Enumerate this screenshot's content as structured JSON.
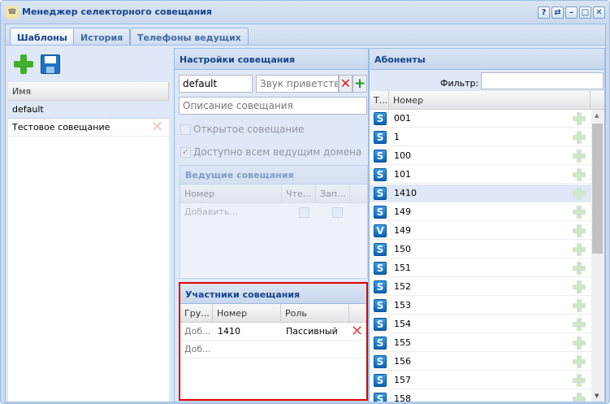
{
  "window": {
    "title": "Менеджер селекторного совещания",
    "buttons": [
      "?",
      "⇄",
      "–",
      "□",
      "✕"
    ]
  },
  "tabs": [
    {
      "label": "Шаблоны",
      "active": true
    },
    {
      "label": "История"
    },
    {
      "label": "Телефоны ведущих"
    }
  ],
  "templates": {
    "column": "Имя",
    "rows": [
      {
        "name": "default",
        "selected": true
      },
      {
        "name": "Тестовое совещание"
      }
    ]
  },
  "settings": {
    "title": "Настройки совещания",
    "name_value": "default",
    "sound_placeholder": "Звук приветствия",
    "description_placeholder": "Описание совещания",
    "open_label": "Открытое совещание",
    "open_checked": false,
    "domain_label": "Доступно всем ведущим домена",
    "domain_checked": true,
    "leaders": {
      "title": "Ведущие совещания",
      "columns": [
        "Номер",
        "Чте...",
        "Зап..."
      ],
      "add_row": "Добавить..."
    }
  },
  "participants": {
    "title": "Участники совещания",
    "columns": [
      "Гру...",
      "Номер",
      "Роль"
    ],
    "rows": [
      {
        "group": "Доб...",
        "number": "1410",
        "role": "Пассивный"
      },
      {
        "group": "Доб...",
        "number": "",
        "role": ""
      }
    ]
  },
  "subscribers": {
    "title": "Абоненты",
    "filter_label": "Фильтр:",
    "filter_value": "",
    "columns": [
      "Т...",
      "Номер"
    ],
    "rows": [
      {
        "type": "S",
        "number": "001"
      },
      {
        "type": "S",
        "number": "1"
      },
      {
        "type": "S",
        "number": "100"
      },
      {
        "type": "S",
        "number": "101"
      },
      {
        "type": "S",
        "number": "1410",
        "selected": true
      },
      {
        "type": "S",
        "number": "149"
      },
      {
        "type": "V",
        "number": "149"
      },
      {
        "type": "S",
        "number": "150"
      },
      {
        "type": "S",
        "number": "151"
      },
      {
        "type": "S",
        "number": "152"
      },
      {
        "type": "S",
        "number": "153"
      },
      {
        "type": "S",
        "number": "154"
      },
      {
        "type": "S",
        "number": "155"
      },
      {
        "type": "S",
        "number": "156"
      },
      {
        "type": "S",
        "number": "157"
      },
      {
        "type": "S",
        "number": "158"
      }
    ]
  },
  "colors": {
    "header_text": "#15428b",
    "highlight_border": "#e00000",
    "panel_bg": "#dfe8f6"
  }
}
